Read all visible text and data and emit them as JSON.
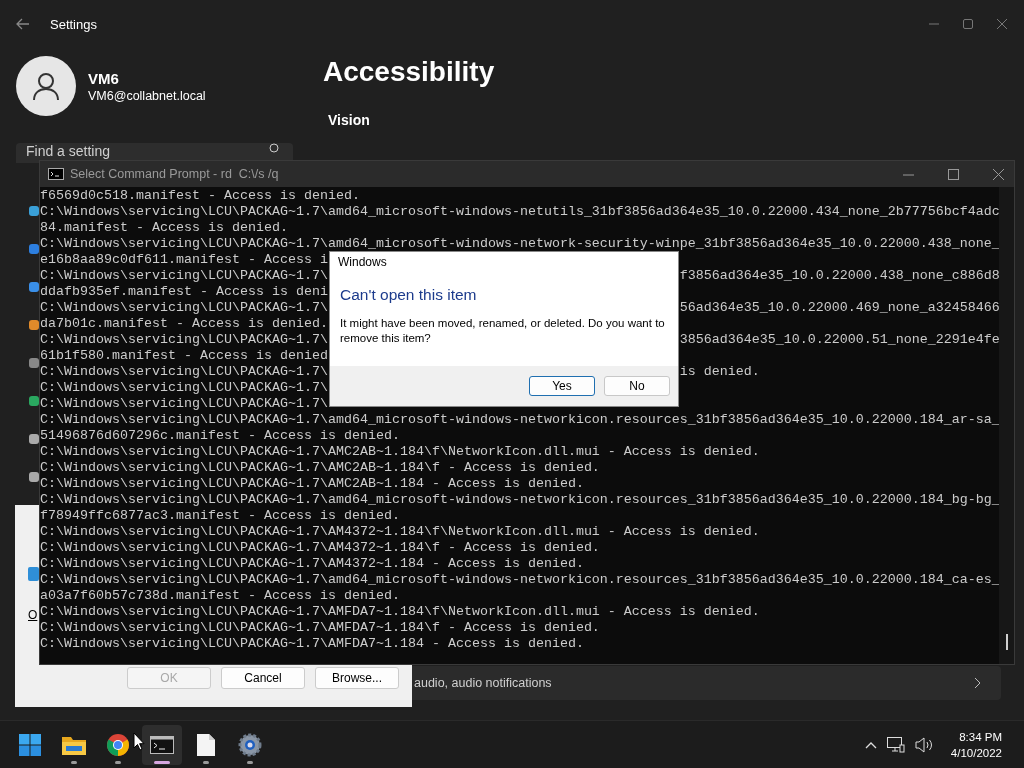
{
  "settings_window": {
    "title": "Settings",
    "user_name": "VM6",
    "user_email": "VM6@collabnet.local",
    "search": {
      "placeholder": "Find a setting"
    },
    "page_title": "Accessibility",
    "section": "Vision",
    "row_text": "audio, audio notifications"
  },
  "run_dialog": {
    "label": "O",
    "buttons": [
      {
        "label": "OK",
        "disabled": true
      },
      {
        "label": "Cancel",
        "disabled": false
      },
      {
        "label": "Browse...",
        "disabled": false
      }
    ]
  },
  "console": {
    "title": "Select Command Prompt - rd  C:\\/s /q",
    "lines": [
      {
        "text": "f6569d0c518.manifest - Access is denied."
      },
      {
        "text": "C:\\Windows\\servicing\\LCU\\PACKAG~1.7\\amd64_microsoft-windows-netutils_31bf3856ad364e35_10.0.22000.434_none_2b77756bcf4adc"
      },
      {
        "text": "84.manifest - Access is denied."
      },
      {
        "text": "C:\\Windows\\servicing\\LCU\\PACKAG~1.7\\amd64_microsoft-windows-network-security-winpe_31bf3856ad364e35_10.0.22000.438_none_"
      },
      {
        "text": "e16b8aa89c0df611.manifest - Access i"
      },
      {
        "text": "C:\\Windows\\servicing\\LCU\\PACKAG~1.7\\",
        "right": "f3856ad364e35_10.0.22000.438_none_c886d8"
      },
      {
        "text": "ddafb935ef.manifest - Access is deni"
      },
      {
        "text": "C:\\Windows\\servicing\\LCU\\PACKAG~1.7\\",
        "right": "56ad364e35_10.0.22000.469_none_a32458466"
      },
      {
        "text": "da7b01c.manifest - Access is denied."
      },
      {
        "text": "C:\\Windows\\servicing\\LCU\\PACKAG~1.7\\",
        "right": "3856ad364e35_10.0.22000.51_none_2291e4fe"
      },
      {
        "text": "61b1f580.manifest - Access is denied"
      },
      {
        "text": "C:\\Windows\\servicing\\LCU\\PACKAG~1.7\\",
        "right": "is denied."
      },
      {
        "text": "C:\\Windows\\servicing\\LCU\\PACKAG~1.7\\"
      },
      {
        "text": "C:\\Windows\\servicing\\LCU\\PACKAG~1.7\\"
      },
      {
        "text": "C:\\Windows\\servicing\\LCU\\PACKAG~1.7\\amd64_microsoft-windows-networkicon.resources_31bf3856ad364e35_10.0.22000.184_ar-sa_"
      },
      {
        "text": "51496876d607296c.manifest - Access is denied."
      },
      {
        "text": "C:\\Windows\\servicing\\LCU\\PACKAG~1.7\\AMC2AB~1.184\\f\\NetworkIcon.dll.mui - Access is denied."
      },
      {
        "text": "C:\\Windows\\servicing\\LCU\\PACKAG~1.7\\AMC2AB~1.184\\f - Access is denied."
      },
      {
        "text": "C:\\Windows\\servicing\\LCU\\PACKAG~1.7\\AMC2AB~1.184 - Access is denied."
      },
      {
        "text": "C:\\Windows\\servicing\\LCU\\PACKAG~1.7\\amd64_microsoft-windows-networkicon.resources_31bf3856ad364e35_10.0.22000.184_bg-bg_"
      },
      {
        "text": "f78949ffc6877ac3.manifest - Access is denied."
      },
      {
        "text": "C:\\Windows\\servicing\\LCU\\PACKAG~1.7\\AM4372~1.184\\f\\NetworkIcon.dll.mui - Access is denied."
      },
      {
        "text": "C:\\Windows\\servicing\\LCU\\PACKAG~1.7\\AM4372~1.184\\f - Access is denied."
      },
      {
        "text": "C:\\Windows\\servicing\\LCU\\PACKAG~1.7\\AM4372~1.184 - Access is denied."
      },
      {
        "text": "C:\\Windows\\servicing\\LCU\\PACKAG~1.7\\amd64_microsoft-windows-networkicon.resources_31bf3856ad364e35_10.0.22000.184_ca-es_"
      },
      {
        "text": "a03a7f60b57c738d.manifest - Access is denied."
      },
      {
        "text": "C:\\Windows\\servicing\\LCU\\PACKAG~1.7\\AMFDA7~1.184\\f\\NetworkIcon.dll.mui - Access is denied."
      },
      {
        "text": "C:\\Windows\\servicing\\LCU\\PACKAG~1.7\\AMFDA7~1.184\\f - Access is denied."
      },
      {
        "text": "C:\\Windows\\servicing\\LCU\\PACKAG~1.7\\AMFDA7~1.184 - Access is denied."
      }
    ]
  },
  "message_box": {
    "title": "Windows",
    "heading": "Can't open this item",
    "message": "It might have been moved, renamed, or deleted. Do you want to remove this item?",
    "buttons": [
      {
        "label": "Yes",
        "selected": true
      },
      {
        "label": "No",
        "selected": false
      }
    ]
  },
  "taskbar": {
    "apps": [
      {
        "kind": "start",
        "running": false,
        "active": false
      },
      {
        "kind": "folder",
        "running": true,
        "active": false
      },
      {
        "kind": "browser",
        "running": true,
        "active": false
      },
      {
        "kind": "terminal",
        "running": true,
        "active": true
      },
      {
        "kind": "document",
        "running": true,
        "active": false
      },
      {
        "kind": "settings",
        "running": true,
        "active": false
      }
    ],
    "time": "8:34 PM",
    "date": "4/10/2022"
  }
}
